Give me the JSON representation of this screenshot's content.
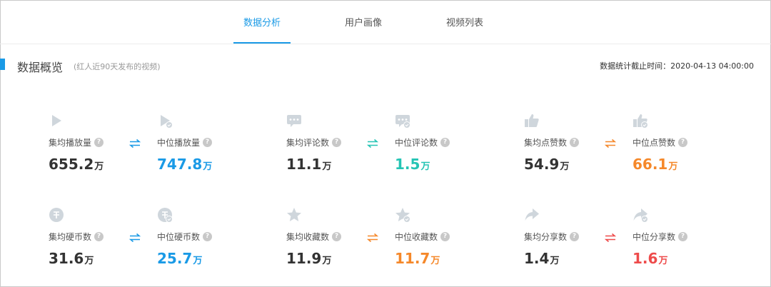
{
  "tabs": [
    {
      "label": "数据分析",
      "active": true
    },
    {
      "label": "用户画像",
      "active": false
    },
    {
      "label": "视频列表",
      "active": false
    }
  ],
  "section": {
    "title": "数据概览",
    "subtitle": "(红人近90天发布的视频)",
    "stat_time": "数据统计截止时间：2020-04-13 04:00:00"
  },
  "colors": {
    "accent": "#1a9ae6",
    "teal": "#25c4b4",
    "orange": "#f5882a",
    "red": "#ee4b4b",
    "dark": "#333333",
    "icon_gray": "#cfd6dc"
  },
  "metrics": [
    {
      "label": "集均播放量",
      "value": "655.2",
      "unit": "万",
      "icon": "play-icon",
      "color": "dark"
    },
    {
      "label": "中位播放量",
      "value": "747.8",
      "unit": "万",
      "icon": "play-median-icon",
      "color": "accent"
    },
    {
      "label": "集均评论数",
      "value": "11.1",
      "unit": "万",
      "icon": "comment-icon",
      "color": "dark"
    },
    {
      "label": "中位评论数",
      "value": "1.5",
      "unit": "万",
      "icon": "comment-median-icon",
      "color": "teal"
    },
    {
      "label": "集均点赞数",
      "value": "54.9",
      "unit": "万",
      "icon": "thumbs-up-icon",
      "color": "dark"
    },
    {
      "label": "中位点赞数",
      "value": "66.1",
      "unit": "万",
      "icon": "thumbs-up-median-icon",
      "color": "orange"
    },
    {
      "label": "集均硬币数",
      "value": "31.6",
      "unit": "万",
      "icon": "coin-icon",
      "color": "dark"
    },
    {
      "label": "中位硬币数",
      "value": "25.7",
      "unit": "万",
      "icon": "coin-median-icon",
      "color": "accent"
    },
    {
      "label": "集均收藏数",
      "value": "11.9",
      "unit": "万",
      "icon": "star-icon",
      "color": "dark"
    },
    {
      "label": "中位收藏数",
      "value": "11.7",
      "unit": "万",
      "icon": "star-median-icon",
      "color": "orange"
    },
    {
      "label": "集均分享数",
      "value": "1.4",
      "unit": "万",
      "icon": "share-icon",
      "color": "dark"
    },
    {
      "label": "中位分享数",
      "value": "1.6",
      "unit": "万",
      "icon": "share-median-icon",
      "color": "red"
    }
  ],
  "swaps": [
    {
      "icon": "swap-icon",
      "color": "accent"
    },
    {
      "icon": "swap-icon",
      "color": "teal"
    },
    {
      "icon": "swap-icon",
      "color": "orange"
    },
    {
      "icon": "swap-icon",
      "color": "accent"
    },
    {
      "icon": "swap-icon",
      "color": "orange"
    },
    {
      "icon": "swap-icon",
      "color": "red"
    }
  ],
  "help_glyph": "?"
}
